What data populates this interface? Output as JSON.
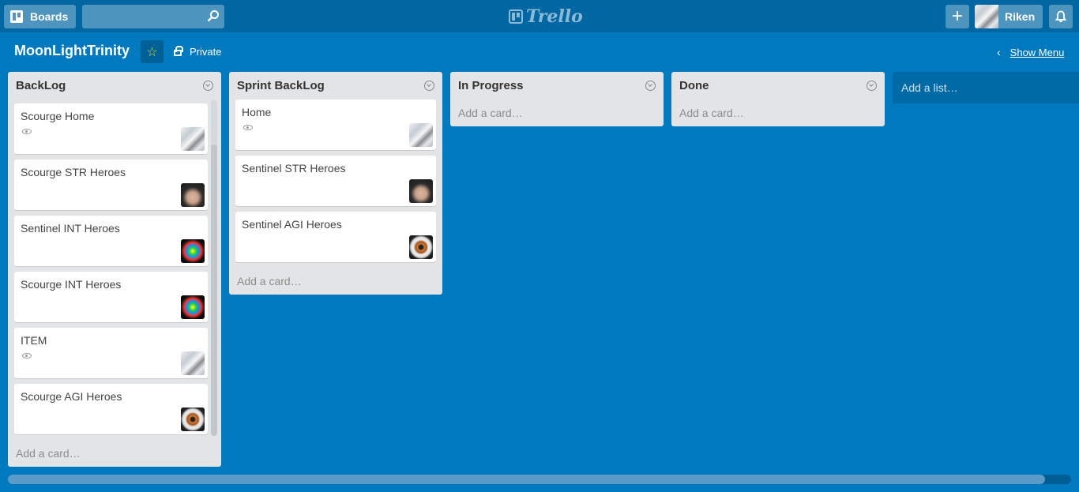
{
  "header": {
    "boards_label": "Boards",
    "search_value": "",
    "logo_text": "Trello",
    "user_name": "Riken"
  },
  "board": {
    "title": "MoonLightTrinity",
    "visibility": "Private",
    "show_menu_label": "Show Menu",
    "add_list_label": "Add a list…"
  },
  "lists": [
    {
      "title": "BackLog",
      "add_card_label": "Add a card…",
      "cards": [
        {
          "title": "Scourge Home",
          "watched": true,
          "member_avatar": "snow"
        },
        {
          "title": "Scourge STR Heroes",
          "watched": false,
          "member_avatar": "anime"
        },
        {
          "title": "Sentinel INT Heroes",
          "watched": false,
          "member_avatar": "color-burst"
        },
        {
          "title": "Scourge INT Heroes",
          "watched": false,
          "member_avatar": "color-burst"
        },
        {
          "title": "ITEM",
          "watched": true,
          "member_avatar": "snow"
        },
        {
          "title": "Scourge AGI Heroes",
          "watched": false,
          "member_avatar": "eye"
        }
      ]
    },
    {
      "title": "Sprint BackLog",
      "add_card_label": "Add a card…",
      "cards": [
        {
          "title": "Home",
          "watched": true,
          "member_avatar": "snow"
        },
        {
          "title": "Sentinel STR Heroes",
          "watched": false,
          "member_avatar": "anime"
        },
        {
          "title": "Sentinel AGI Heroes",
          "watched": false,
          "member_avatar": "eye"
        }
      ]
    },
    {
      "title": "In Progress",
      "add_card_label": "Add a card…",
      "cards": []
    },
    {
      "title": "Done",
      "add_card_label": "Add a card…",
      "cards": []
    }
  ],
  "colors": {
    "board_bg": "#0079bf",
    "header_bg": "#0067a3",
    "list_bg": "#e2e4e6",
    "star": "#f2d600"
  }
}
